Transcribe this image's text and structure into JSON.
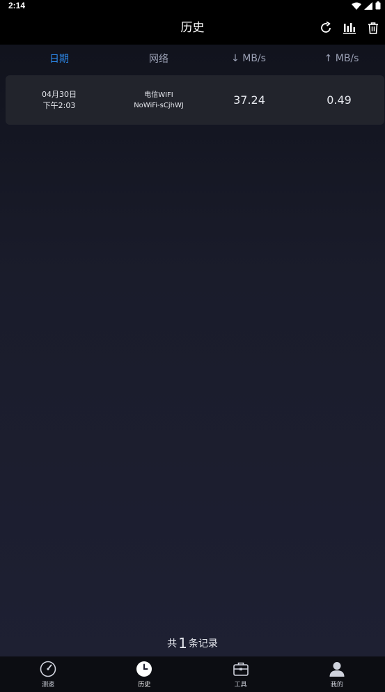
{
  "status_bar": {
    "time": "2:14"
  },
  "header": {
    "title": "历史"
  },
  "columns": {
    "date": "日期",
    "network": "网络",
    "download": "↓ MB/s",
    "upload": "↑ MB/s"
  },
  "records": [
    {
      "date": "04月30日",
      "time": "下午2:03",
      "network_type": "电信WIFI",
      "ssid": "NoWiFi-sCjhWJ",
      "download": "37.24",
      "upload": "0.49"
    }
  ],
  "summary": {
    "prefix": "共",
    "count": "1",
    "suffix": "条记录"
  },
  "nav": [
    {
      "label": "测速",
      "icon": "speedometer-icon"
    },
    {
      "label": "历史",
      "icon": "history-clock-icon",
      "active": true
    },
    {
      "label": "工具",
      "icon": "toolbox-icon"
    },
    {
      "label": "我的",
      "icon": "user-profile-icon"
    }
  ],
  "colors": {
    "accent": "#2d8cf0",
    "card": "#22242c",
    "bar": "#000000"
  }
}
